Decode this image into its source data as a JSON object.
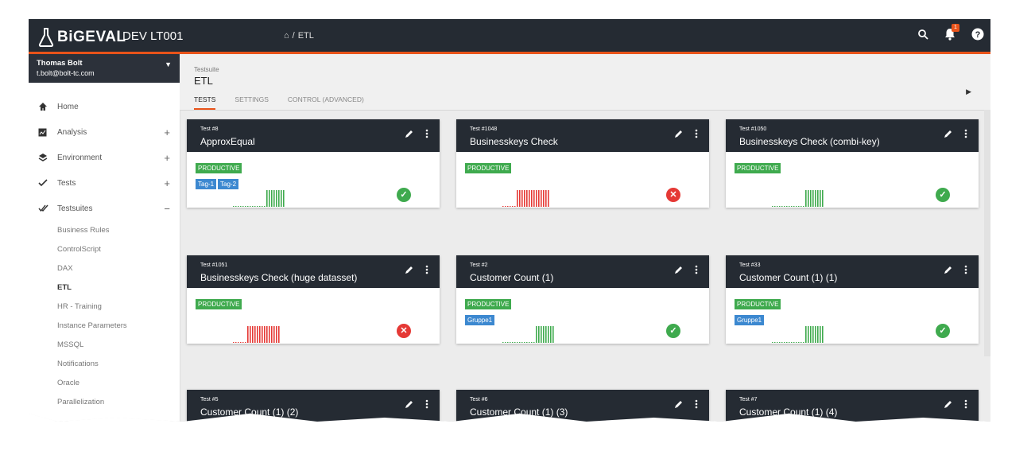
{
  "app": {
    "brand": "BiGEVAL",
    "environment": "DEV LT001",
    "breadcrumb": [
      "⌂",
      "/",
      "ETL"
    ],
    "notifications_count": "1"
  },
  "user": {
    "name": "Thomas Bolt",
    "email": "t.bolt@bolt-tc.com"
  },
  "nav": [
    {
      "label": "Home",
      "icon": "home-icon",
      "toggle": ""
    },
    {
      "label": "Analysis",
      "icon": "analysis-icon",
      "toggle": "+"
    },
    {
      "label": "Environment",
      "icon": "layers-icon",
      "toggle": "+"
    },
    {
      "label": "Tests",
      "icon": "check-icon",
      "toggle": "+"
    },
    {
      "label": "Testsuites",
      "icon": "double-check-icon",
      "toggle": "−"
    }
  ],
  "testsuites": [
    "Business Rules",
    "ControlScript",
    "DAX",
    "ETL",
    "HR - Training",
    "Instance Parameters",
    "MSSQL",
    "Notifications",
    "Oracle",
    "Parallelization"
  ],
  "active_testsuite": "ETL",
  "header": {
    "label": "Testsuite",
    "title": "ETL",
    "tabs": [
      "TESTS",
      "SETTINGS",
      "CONTROL (ADVANCED)"
    ]
  },
  "colors": {
    "accent": "#e9531a",
    "dark": "#252b33",
    "success": "#3faa4e",
    "error": "#e53935",
    "tag_blue": "#3c88d0"
  },
  "cards": [
    {
      "id": "Test #8",
      "name": "ApproxEqual",
      "tags": [
        {
          "label": "PRODUCTIVE",
          "kind": "green"
        },
        {
          "label": "Tag-1",
          "kind": "blue"
        },
        {
          "label": "Tag-2",
          "kind": "blue"
        }
      ],
      "status": "success"
    },
    {
      "id": "Test #1048",
      "name": "Businesskeys Check",
      "tags": [
        {
          "label": "PRODUCTIVE",
          "kind": "green"
        }
      ],
      "status": "error"
    },
    {
      "id": "Test #1050",
      "name": "Businesskeys Check (combi-key)",
      "tags": [
        {
          "label": "PRODUCTIVE",
          "kind": "green"
        }
      ],
      "status": "success"
    },
    {
      "id": "Test #1051",
      "name": "Businesskeys Check (huge datasset)",
      "tags": [
        {
          "label": "PRODUCTIVE",
          "kind": "green"
        }
      ],
      "status": "error"
    },
    {
      "id": "Test #2",
      "name": "Customer Count (1)",
      "tags": [
        {
          "label": "PRODUCTIVE",
          "kind": "green"
        },
        {
          "label": "Gruppe1",
          "kind": "blue"
        }
      ],
      "status": "success"
    },
    {
      "id": "Test #33",
      "name": "Customer Count (1) (1)",
      "tags": [
        {
          "label": "PRODUCTIVE",
          "kind": "green"
        },
        {
          "label": "Gruppe1",
          "kind": "blue"
        }
      ],
      "status": "success"
    },
    {
      "id": "Test #5",
      "name": "Customer Count (1) (2)",
      "tags": [],
      "status": ""
    },
    {
      "id": "Test #6",
      "name": "Customer Count (1) (3)",
      "tags": [],
      "status": ""
    },
    {
      "id": "Test #7",
      "name": "Customer Count (1) (4)",
      "tags": [],
      "status": ""
    }
  ]
}
